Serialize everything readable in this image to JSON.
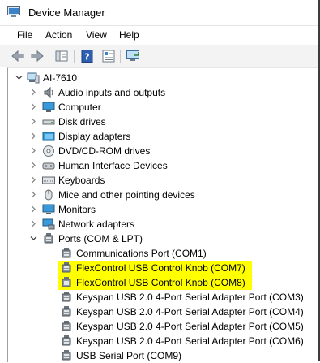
{
  "window": {
    "title": "Device Manager"
  },
  "menu": {
    "file": "File",
    "action": "Action",
    "view": "View",
    "help": "Help"
  },
  "toolbar": {
    "icons": [
      "back-arrow-icon",
      "forward-arrow-icon",
      "show-hide-tree-icon",
      "help-icon",
      "properties-icon",
      "monitor-scan-icon"
    ]
  },
  "tree": {
    "root": {
      "label": "AI-7610",
      "expanded": true
    },
    "categories": [
      {
        "label": "Audio inputs and outputs",
        "icon": "speaker-icon",
        "expanded": false
      },
      {
        "label": "Computer",
        "icon": "computer-icon",
        "expanded": false
      },
      {
        "label": "Disk drives",
        "icon": "disk-drive-icon",
        "expanded": false
      },
      {
        "label": "Display adapters",
        "icon": "display-adapter-icon",
        "expanded": false
      },
      {
        "label": "DVD/CD-ROM drives",
        "icon": "dvd-drive-icon",
        "expanded": false
      },
      {
        "label": "Human Interface Devices",
        "icon": "hid-icon",
        "expanded": false
      },
      {
        "label": "Keyboards",
        "icon": "keyboard-icon",
        "expanded": false
      },
      {
        "label": "Mice and other pointing devices",
        "icon": "mouse-icon",
        "expanded": false
      },
      {
        "label": "Monitors",
        "icon": "monitor-icon",
        "expanded": false
      },
      {
        "label": "Network adapters",
        "icon": "network-adapter-icon",
        "expanded": false
      },
      {
        "label": "Ports (COM & LPT)",
        "icon": "port-icon",
        "expanded": true
      }
    ],
    "ports": [
      {
        "label": "Communications Port (COM1)",
        "highlighted": false
      },
      {
        "label": "FlexControl USB Control Knob (COM7)",
        "highlighted": true
      },
      {
        "label": "FlexControl USB Control Knob (COM8)",
        "highlighted": true
      },
      {
        "label": "Keyspan USB 2.0 4-Port Serial Adapter Port (COM3)",
        "highlighted": false
      },
      {
        "label": "Keyspan USB 2.0 4-Port Serial Adapter Port (COM4)",
        "highlighted": false
      },
      {
        "label": "Keyspan USB 2.0 4-Port Serial Adapter Port (COM5)",
        "highlighted": false
      },
      {
        "label": "Keyspan USB 2.0 4-Port Serial Adapter Port (COM6)",
        "highlighted": false
      },
      {
        "label": "USB Serial Port (COM9)",
        "highlighted": false
      }
    ]
  },
  "colors": {
    "highlight": "#ffff00",
    "toolbar_bg": "#f3f3f3"
  }
}
